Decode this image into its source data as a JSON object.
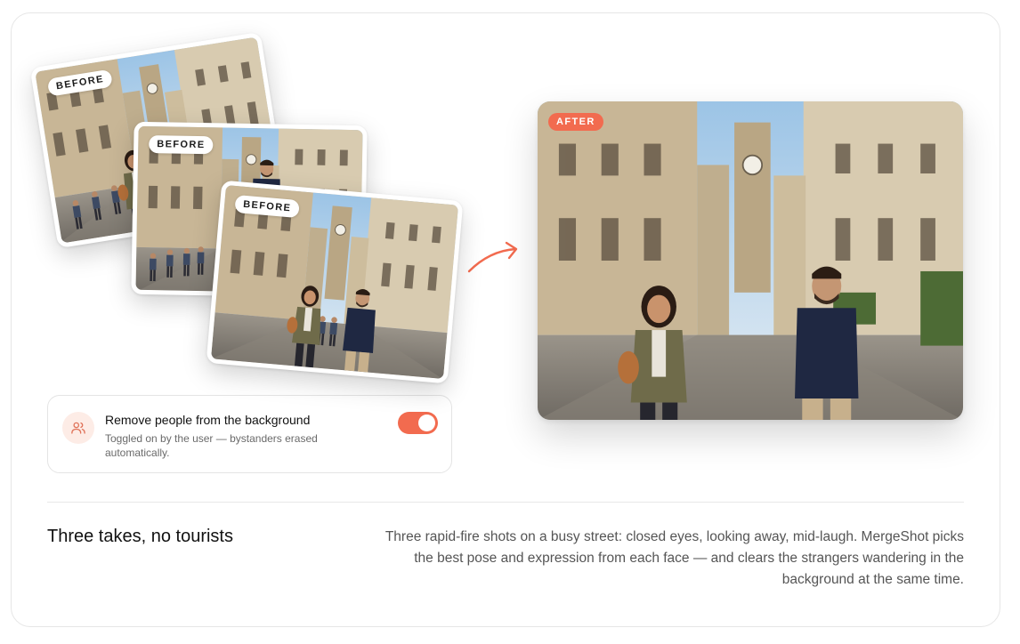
{
  "before_photos": [
    {
      "badge": "BEFORE"
    },
    {
      "badge": "BEFORE"
    },
    {
      "badge": "BEFORE"
    }
  ],
  "after_photo": {
    "badge": "AFTER"
  },
  "option": {
    "icon": "people-icon",
    "title": "Remove people from the background",
    "subtitle": "Toggled on by the user — bystanders erased automatically.",
    "toggle_on": true
  },
  "feature": {
    "title": "Three takes, no tourists",
    "description": "Three rapid-fire shots on a busy street: closed eyes, looking away, mid-laugh. MergeShot picks the best pose and expression from each face — and clears the strangers wandering in the background at the same time."
  },
  "colors": {
    "accent": "#f26b4f",
    "accent_soft": "#fdece6",
    "border": "#e6e6e6",
    "text": "#111111",
    "muted": "#555555"
  }
}
